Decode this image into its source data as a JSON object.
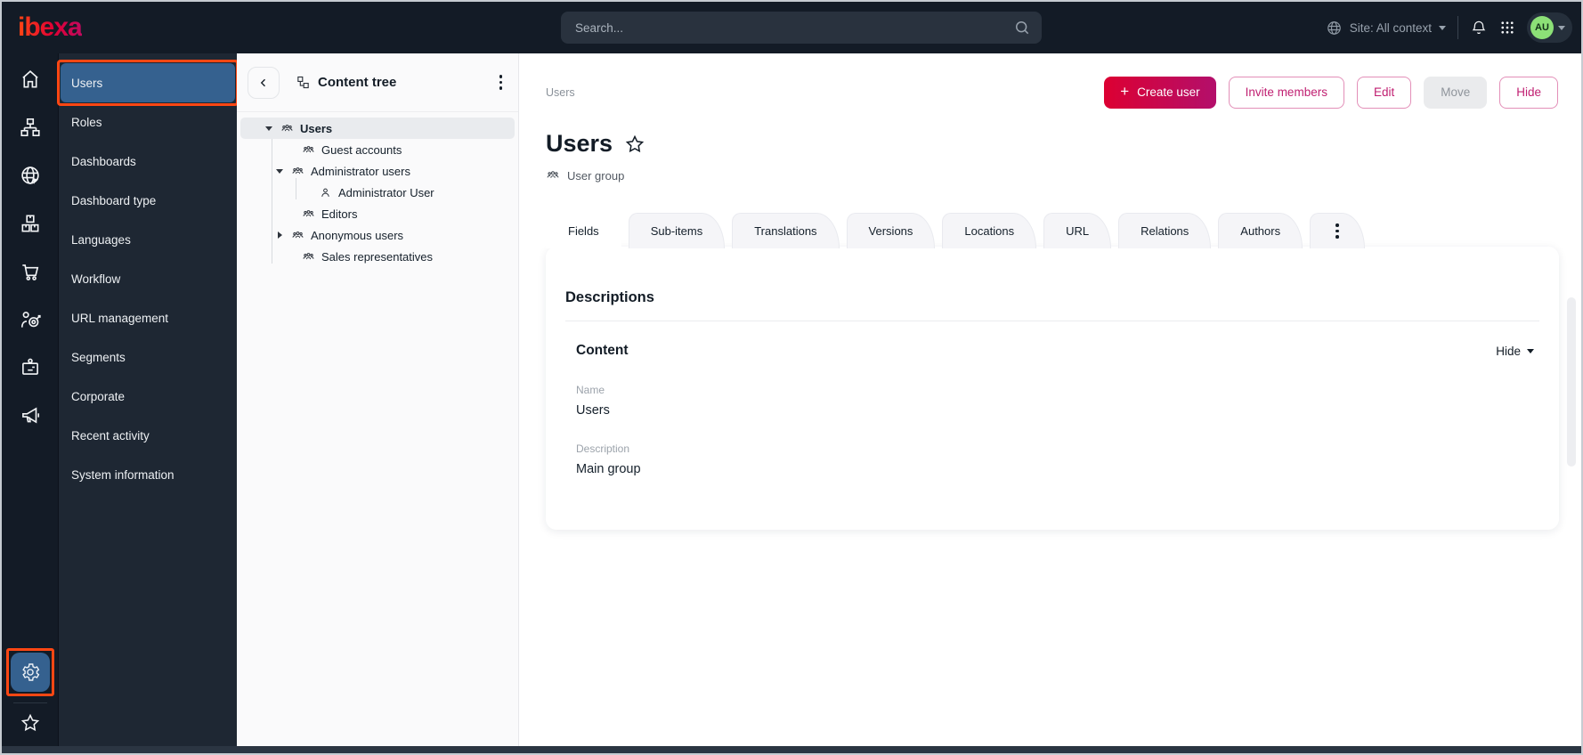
{
  "topbar": {
    "logo": "ibexa",
    "search_placeholder": "Search...",
    "site_context": "Site: All context",
    "avatar_initials": "AU"
  },
  "icon_rail": {
    "icons": [
      "home",
      "sitemap",
      "globe",
      "packages",
      "cart",
      "audience-target",
      "id-badge",
      "megaphone",
      "gear",
      "star"
    ]
  },
  "sidebar": {
    "items": [
      {
        "label": "Users",
        "active": true,
        "annotated": true
      },
      {
        "label": "Roles"
      },
      {
        "label": "Dashboards"
      },
      {
        "label": "Dashboard type"
      },
      {
        "label": "Languages"
      },
      {
        "label": "Workflow"
      },
      {
        "label": "URL management"
      },
      {
        "label": "Segments"
      },
      {
        "label": "Corporate"
      },
      {
        "label": "Recent activity"
      },
      {
        "label": "System information"
      }
    ]
  },
  "content_tree": {
    "title": "Content tree",
    "items": [
      {
        "label": "Users",
        "level": 0,
        "caret": "down",
        "icon": "user-group",
        "selected": true
      },
      {
        "label": "Guest accounts",
        "level": 1,
        "caret": "none",
        "icon": "user-group"
      },
      {
        "label": "Administrator users",
        "level": 1,
        "caret": "down",
        "icon": "user-group"
      },
      {
        "label": "Administrator User",
        "level": 2,
        "caret": "none",
        "icon": "user"
      },
      {
        "label": "Editors",
        "level": 1,
        "caret": "none",
        "icon": "user-group"
      },
      {
        "label": "Anonymous users",
        "level": 1,
        "caret": "right",
        "icon": "user-group"
      },
      {
        "label": "Sales representatives",
        "level": 1,
        "caret": "none",
        "icon": "user-group"
      }
    ]
  },
  "main": {
    "breadcrumb": "Users",
    "actions": {
      "create_user": "Create user",
      "invite_members": "Invite members",
      "edit": "Edit",
      "move": "Move",
      "hide": "Hide",
      "move_disabled": true
    },
    "title": "Users",
    "content_type": "User group",
    "tabs": [
      {
        "label": "Fields",
        "active": true
      },
      {
        "label": "Sub-items"
      },
      {
        "label": "Translations"
      },
      {
        "label": "Versions"
      },
      {
        "label": "Locations"
      },
      {
        "label": "URL"
      },
      {
        "label": "Relations"
      },
      {
        "label": "Authors"
      }
    ],
    "card": {
      "section_title": "Descriptions",
      "group_title": "Content",
      "collapse_label": "Hide",
      "fields": [
        {
          "label": "Name",
          "value": "Users"
        },
        {
          "label": "Description",
          "value": "Main group"
        }
      ]
    }
  },
  "colors": {
    "annotation_orange": "#FF4713",
    "primary_gradient_start": "#DC0032",
    "primary_gradient_end": "#B30F6B",
    "selected_blue": "#35618F",
    "avatar_green": "#8CE077",
    "topbar_bg": "#131B26",
    "menu_bg": "#1E2733"
  }
}
